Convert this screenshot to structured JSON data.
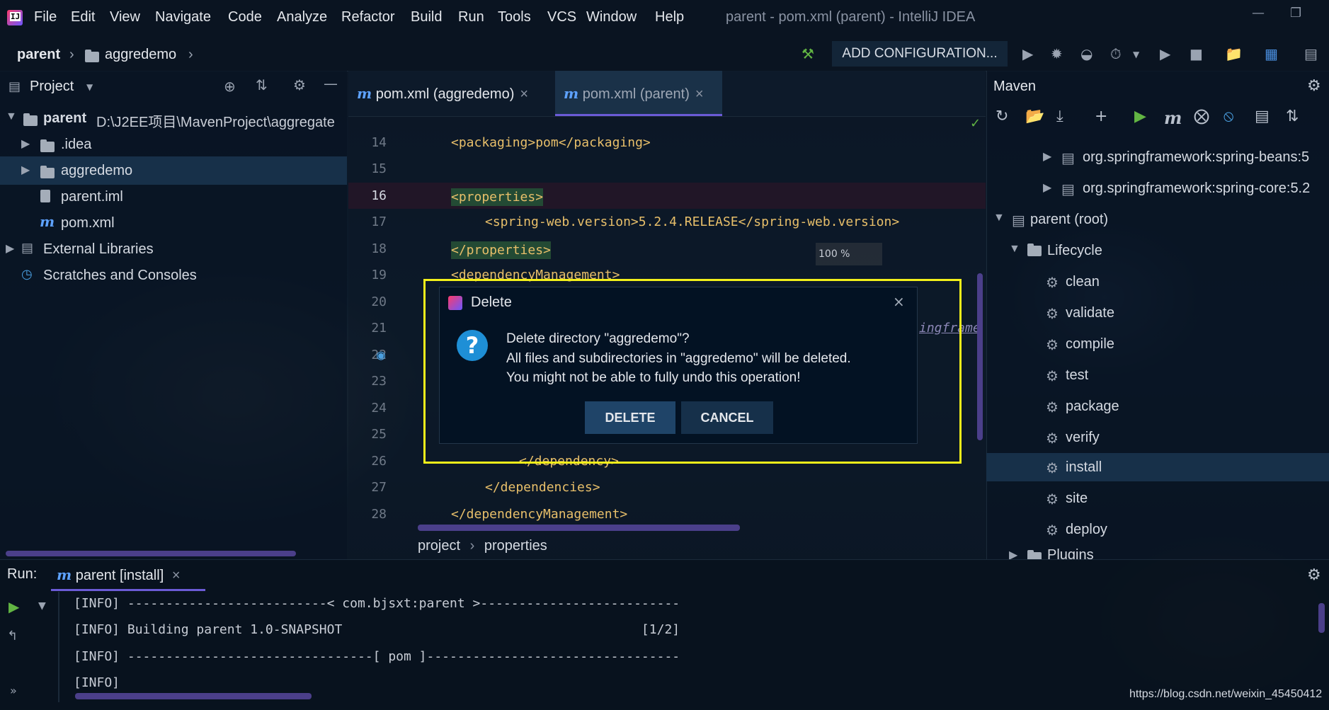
{
  "app": {
    "window_title": "parent - pom.xml (parent) - IntelliJ IDEA",
    "menu": [
      "File",
      "Edit",
      "View",
      "Navigate",
      "Code",
      "Analyze",
      "Refactor",
      "Build",
      "Run",
      "Tools",
      "VCS",
      "Window",
      "Help"
    ]
  },
  "navbar": {
    "breadcrumb": [
      "parent",
      "aggredemo"
    ],
    "run_config_label": "ADD CONFIGURATION..."
  },
  "project_panel": {
    "title": "Project",
    "tree": [
      {
        "label": "parent",
        "path": "D:\\J2EE项目\\MavenProject\\aggregate",
        "icon": "module-folder-icon",
        "expanded": true
      },
      {
        "label": ".idea",
        "icon": "folder-icon"
      },
      {
        "label": "aggredemo",
        "icon": "folder-icon",
        "selected": true
      },
      {
        "label": "parent.iml",
        "icon": "iml-file-icon"
      },
      {
        "label": "pom.xml",
        "icon": "maven-file-icon"
      },
      {
        "label": "External Libraries",
        "icon": "library-icon"
      },
      {
        "label": "Scratches and Consoles",
        "icon": "scratch-icon"
      }
    ]
  },
  "editor": {
    "tabs": [
      {
        "label": "pom.xml (aggredemo)",
        "active": false
      },
      {
        "label": "pom.xml (parent)",
        "active": true
      }
    ],
    "lines": [
      {
        "n": "14",
        "text": "<packaging>pom</packaging>"
      },
      {
        "n": "15",
        "text": ""
      },
      {
        "n": "16",
        "text": "<properties>"
      },
      {
        "n": "17",
        "text": "<spring-web.version>5.2.4.RELEASE</spring-web.version>"
      },
      {
        "n": "18",
        "text": "</properties>"
      },
      {
        "n": "19",
        "text": "<dependencyManagement>"
      },
      {
        "n": "20",
        "text": ""
      },
      {
        "n": "21",
        "text": ""
      },
      {
        "n": "22",
        "text": ""
      },
      {
        "n": "23",
        "text": ""
      },
      {
        "n": "24",
        "text": ""
      },
      {
        "n": "25",
        "text": ""
      },
      {
        "n": "26",
        "text": "</dependency>"
      },
      {
        "n": "27",
        "text": "</dependencies>"
      },
      {
        "n": "28",
        "text": "</dependencyManagement>"
      }
    ],
    "line21_tail": "ingframe",
    "zoom": "100 %",
    "breadcrumbs": [
      "project",
      "properties"
    ]
  },
  "maven_panel": {
    "title": "Maven",
    "rows": [
      {
        "label": "org.springframework:spring-beans:5",
        "icon": "library-icon"
      },
      {
        "label": "org.springframework:spring-core:5.2",
        "icon": "library-icon"
      },
      {
        "label": "parent (root)",
        "icon": "maven-module-icon"
      },
      {
        "label": "Lifecycle",
        "icon": "lifecycle-folder-icon"
      },
      {
        "label": "clean",
        "icon": "gear-icon"
      },
      {
        "label": "validate",
        "icon": "gear-icon"
      },
      {
        "label": "compile",
        "icon": "gear-icon"
      },
      {
        "label": "test",
        "icon": "gear-icon"
      },
      {
        "label": "package",
        "icon": "gear-icon"
      },
      {
        "label": "verify",
        "icon": "gear-icon"
      },
      {
        "label": "install",
        "icon": "gear-icon",
        "selected": true
      },
      {
        "label": "site",
        "icon": "gear-icon"
      },
      {
        "label": "deploy",
        "icon": "gear-icon"
      },
      {
        "label": "Plugins",
        "icon": "folder-icon"
      }
    ]
  },
  "dialog": {
    "title": "Delete",
    "line1": "Delete directory \"aggredemo\"?",
    "line2": "All files and subdirectories in \"aggredemo\" will be deleted.",
    "line3": "You might not be able to fully undo this operation!",
    "delete_label": "DELETE",
    "cancel_label": "CANCEL",
    "highlight_color": "#f3f01a"
  },
  "run_panel": {
    "label": "Run:",
    "tab_label": "parent [install]",
    "log": [
      "[INFO] --------------------------< com.bjsxt:parent >--------------------------",
      "[INFO] Building parent 1.0-SNAPSHOT                                       [1/2]",
      "[INFO] --------------------------------[ pom ]---------------------------------",
      "[INFO]"
    ]
  },
  "watermark": "https://blog.csdn.net/weixin_45450412",
  "colors": {
    "accent": "#6b5bd6",
    "selection": "#173049",
    "tag": "#e8bf6a",
    "maven_icon": "#5ea2ff"
  }
}
